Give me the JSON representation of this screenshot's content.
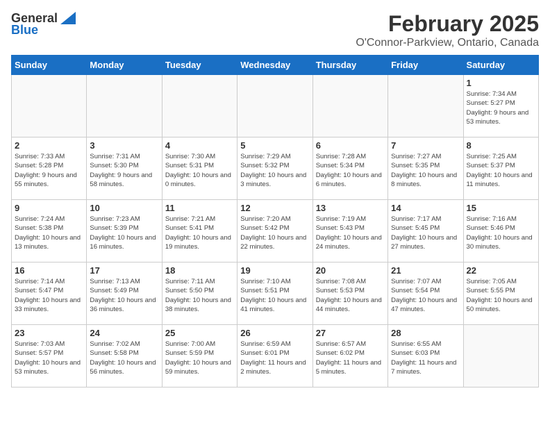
{
  "header": {
    "logo_general": "General",
    "logo_blue": "Blue",
    "month_title": "February 2025",
    "location": "O'Connor-Parkview, Ontario, Canada"
  },
  "weekdays": [
    "Sunday",
    "Monday",
    "Tuesday",
    "Wednesday",
    "Thursday",
    "Friday",
    "Saturday"
  ],
  "weeks": [
    [
      {
        "day": "",
        "info": ""
      },
      {
        "day": "",
        "info": ""
      },
      {
        "day": "",
        "info": ""
      },
      {
        "day": "",
        "info": ""
      },
      {
        "day": "",
        "info": ""
      },
      {
        "day": "",
        "info": ""
      },
      {
        "day": "1",
        "info": "Sunrise: 7:34 AM\nSunset: 5:27 PM\nDaylight: 9 hours and 53 minutes."
      }
    ],
    [
      {
        "day": "2",
        "info": "Sunrise: 7:33 AM\nSunset: 5:28 PM\nDaylight: 9 hours and 55 minutes."
      },
      {
        "day": "3",
        "info": "Sunrise: 7:31 AM\nSunset: 5:30 PM\nDaylight: 9 hours and 58 minutes."
      },
      {
        "day": "4",
        "info": "Sunrise: 7:30 AM\nSunset: 5:31 PM\nDaylight: 10 hours and 0 minutes."
      },
      {
        "day": "5",
        "info": "Sunrise: 7:29 AM\nSunset: 5:32 PM\nDaylight: 10 hours and 3 minutes."
      },
      {
        "day": "6",
        "info": "Sunrise: 7:28 AM\nSunset: 5:34 PM\nDaylight: 10 hours and 6 minutes."
      },
      {
        "day": "7",
        "info": "Sunrise: 7:27 AM\nSunset: 5:35 PM\nDaylight: 10 hours and 8 minutes."
      },
      {
        "day": "8",
        "info": "Sunrise: 7:25 AM\nSunset: 5:37 PM\nDaylight: 10 hours and 11 minutes."
      }
    ],
    [
      {
        "day": "9",
        "info": "Sunrise: 7:24 AM\nSunset: 5:38 PM\nDaylight: 10 hours and 13 minutes."
      },
      {
        "day": "10",
        "info": "Sunrise: 7:23 AM\nSunset: 5:39 PM\nDaylight: 10 hours and 16 minutes."
      },
      {
        "day": "11",
        "info": "Sunrise: 7:21 AM\nSunset: 5:41 PM\nDaylight: 10 hours and 19 minutes."
      },
      {
        "day": "12",
        "info": "Sunrise: 7:20 AM\nSunset: 5:42 PM\nDaylight: 10 hours and 22 minutes."
      },
      {
        "day": "13",
        "info": "Sunrise: 7:19 AM\nSunset: 5:43 PM\nDaylight: 10 hours and 24 minutes."
      },
      {
        "day": "14",
        "info": "Sunrise: 7:17 AM\nSunset: 5:45 PM\nDaylight: 10 hours and 27 minutes."
      },
      {
        "day": "15",
        "info": "Sunrise: 7:16 AM\nSunset: 5:46 PM\nDaylight: 10 hours and 30 minutes."
      }
    ],
    [
      {
        "day": "16",
        "info": "Sunrise: 7:14 AM\nSunset: 5:47 PM\nDaylight: 10 hours and 33 minutes."
      },
      {
        "day": "17",
        "info": "Sunrise: 7:13 AM\nSunset: 5:49 PM\nDaylight: 10 hours and 36 minutes."
      },
      {
        "day": "18",
        "info": "Sunrise: 7:11 AM\nSunset: 5:50 PM\nDaylight: 10 hours and 38 minutes."
      },
      {
        "day": "19",
        "info": "Sunrise: 7:10 AM\nSunset: 5:51 PM\nDaylight: 10 hours and 41 minutes."
      },
      {
        "day": "20",
        "info": "Sunrise: 7:08 AM\nSunset: 5:53 PM\nDaylight: 10 hours and 44 minutes."
      },
      {
        "day": "21",
        "info": "Sunrise: 7:07 AM\nSunset: 5:54 PM\nDaylight: 10 hours and 47 minutes."
      },
      {
        "day": "22",
        "info": "Sunrise: 7:05 AM\nSunset: 5:55 PM\nDaylight: 10 hours and 50 minutes."
      }
    ],
    [
      {
        "day": "23",
        "info": "Sunrise: 7:03 AM\nSunset: 5:57 PM\nDaylight: 10 hours and 53 minutes."
      },
      {
        "day": "24",
        "info": "Sunrise: 7:02 AM\nSunset: 5:58 PM\nDaylight: 10 hours and 56 minutes."
      },
      {
        "day": "25",
        "info": "Sunrise: 7:00 AM\nSunset: 5:59 PM\nDaylight: 10 hours and 59 minutes."
      },
      {
        "day": "26",
        "info": "Sunrise: 6:59 AM\nSunset: 6:01 PM\nDaylight: 11 hours and 2 minutes."
      },
      {
        "day": "27",
        "info": "Sunrise: 6:57 AM\nSunset: 6:02 PM\nDaylight: 11 hours and 5 minutes."
      },
      {
        "day": "28",
        "info": "Sunrise: 6:55 AM\nSunset: 6:03 PM\nDaylight: 11 hours and 7 minutes."
      },
      {
        "day": "",
        "info": ""
      }
    ]
  ]
}
